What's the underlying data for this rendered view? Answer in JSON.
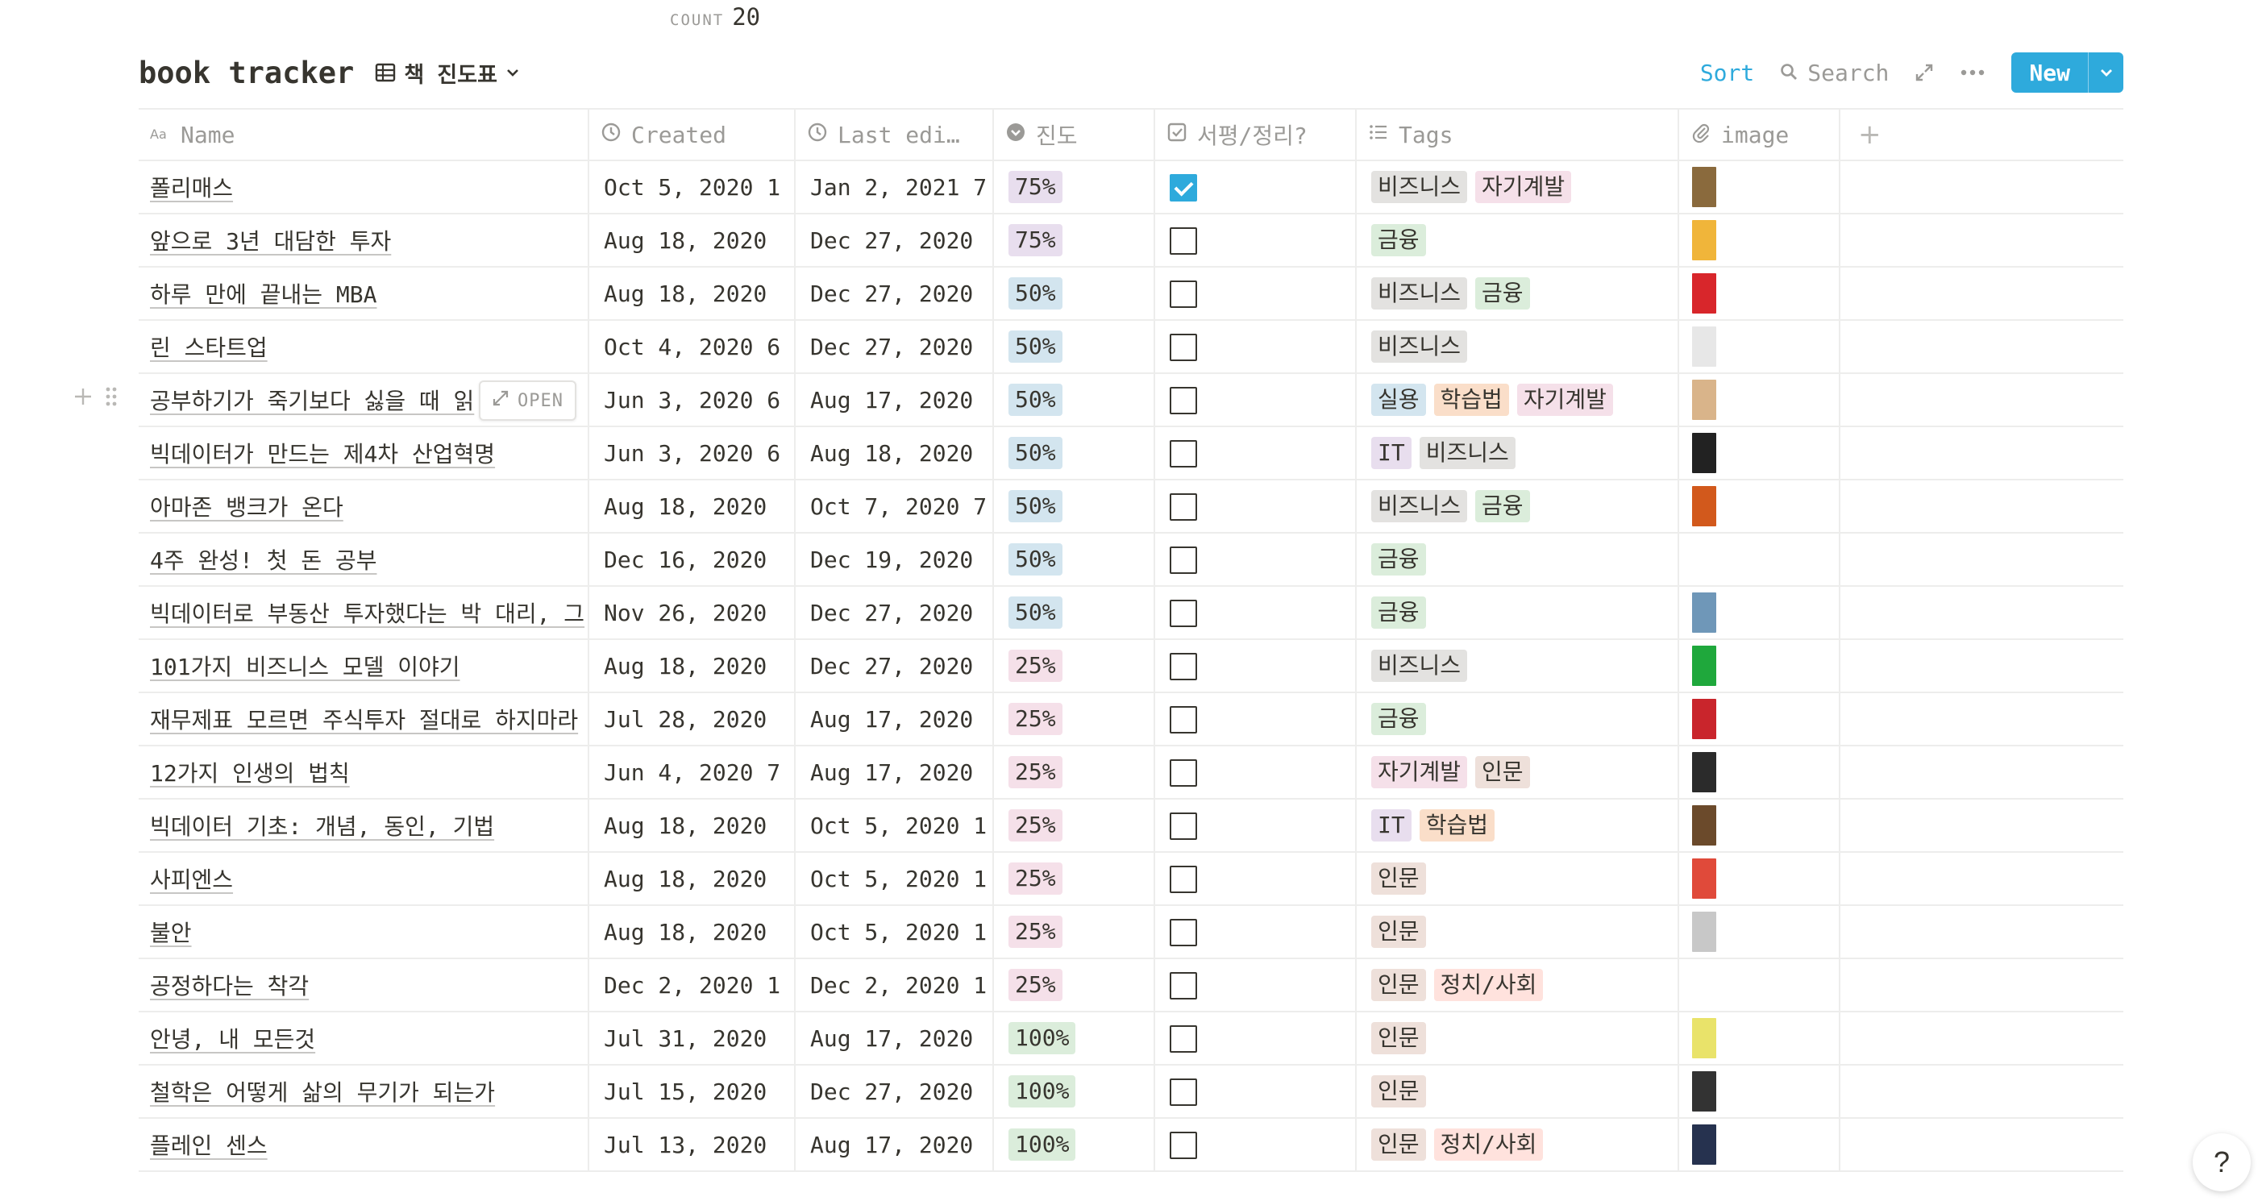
{
  "count": {
    "label": "COUNT",
    "value": "20"
  },
  "header": {
    "title": "book tracker",
    "view_name": "책 진도표",
    "sort": "Sort",
    "search": "Search",
    "new": "New"
  },
  "columns": [
    {
      "label": "Name",
      "icon": "text-property-icon"
    },
    {
      "label": "Created",
      "icon": "clock-icon"
    },
    {
      "label": "Last edi…",
      "icon": "clock-icon"
    },
    {
      "label": "진도",
      "icon": "select-icon"
    },
    {
      "label": "서평/정리?",
      "icon": "checkbox-icon"
    },
    {
      "label": "Tags",
      "icon": "list-icon"
    },
    {
      "label": "image",
      "icon": "paperclip-icon"
    }
  ],
  "add_column": "+",
  "open_button": "OPEN",
  "help": "?",
  "tag_colors": {
    "비즈니스": "#e3e2e0",
    "자기계발": "#f5e0e9",
    "금융": "#dbeddb",
    "실용": "#d3e5ef",
    "학습법": "#fadec9",
    "IT": "#e8deee",
    "인문": "#eee0da",
    "정치/사회": "#ffe2dd"
  },
  "progress_colors": {
    "75%": "#e8deee",
    "50%": "#d3e5ef",
    "25%": "#f5e0e9",
    "100%": "#dbeddb"
  },
  "rows": [
    {
      "name": "폴리매스",
      "created": "Oct 5, 2020 1",
      "edited": "Jan 2, 2021 7",
      "progress": "75%",
      "checked": true,
      "tags": [
        "비즈니스",
        "자기계발"
      ],
      "image": "#8a6a3d"
    },
    {
      "name": "앞으로 3년 대담한 투자",
      "created": "Aug 18, 2020",
      "edited": "Dec 27, 2020",
      "progress": "75%",
      "checked": false,
      "tags": [
        "금융"
      ],
      "image": "#f0b53a"
    },
    {
      "name": "하루 만에 끝내는 MBA",
      "created": "Aug 18, 2020",
      "edited": "Dec 27, 2020",
      "progress": "50%",
      "checked": false,
      "tags": [
        "비즈니스",
        "금융"
      ],
      "image": "#d8262b"
    },
    {
      "name": "린 스타트업",
      "created": "Oct 4, 2020 6",
      "edited": "Dec 27, 2020",
      "progress": "50%",
      "checked": false,
      "tags": [
        "비즈니스"
      ],
      "image": "#e7e7e7"
    },
    {
      "name": "공부하기가 죽기보다 싫을 때 읽",
      "created": "Jun 3, 2020 6",
      "edited": "Aug 17, 2020",
      "progress": "50%",
      "checked": false,
      "tags": [
        "실용",
        "학습법",
        "자기계발"
      ],
      "image": "#d9b48a"
    },
    {
      "name": "빅데이터가 만드는 제4차 산업혁명",
      "created": "Jun 3, 2020 6",
      "edited": "Aug 18, 2020",
      "progress": "50%",
      "checked": false,
      "tags": [
        "IT",
        "비즈니스"
      ],
      "image": "#222222"
    },
    {
      "name": "아마존 뱅크가 온다",
      "created": "Aug 18, 2020",
      "edited": "Oct 7, 2020 7",
      "progress": "50%",
      "checked": false,
      "tags": [
        "비즈니스",
        "금융"
      ],
      "image": "#d2591c"
    },
    {
      "name": "4주 완성! 첫 돈 공부",
      "created": "Dec 16, 2020",
      "edited": "Dec 19, 2020",
      "progress": "50%",
      "checked": false,
      "tags": [
        "금융"
      ],
      "image": ""
    },
    {
      "name": "빅데이터로 부동산 투자했다는 박 대리, 그",
      "created": "Nov 26, 2020",
      "edited": "Dec 27, 2020",
      "progress": "50%",
      "checked": false,
      "tags": [
        "금융"
      ],
      "image": "#6f97b8"
    },
    {
      "name": "101가지 비즈니스 모델 이야기",
      "created": "Aug 18, 2020",
      "edited": "Dec 27, 2020",
      "progress": "25%",
      "checked": false,
      "tags": [
        "비즈니스"
      ],
      "image": "#1fa83c"
    },
    {
      "name": "재무제표 모르면 주식투자 절대로 하지마라",
      "created": "Jul 28, 2020",
      "edited": "Aug 17, 2020",
      "progress": "25%",
      "checked": false,
      "tags": [
        "금융"
      ],
      "image": "#c9252c"
    },
    {
      "name": "12가지 인생의 법칙",
      "created": "Jun 4, 2020 7",
      "edited": "Aug 17, 2020",
      "progress": "25%",
      "checked": false,
      "tags": [
        "자기계발",
        "인문"
      ],
      "image": "#2b2b2b"
    },
    {
      "name": "빅데이터 기초: 개념, 동인, 기법",
      "created": "Aug 18, 2020",
      "edited": "Oct 5, 2020 1",
      "progress": "25%",
      "checked": false,
      "tags": [
        "IT",
        "학습법"
      ],
      "image": "#6b4a2b"
    },
    {
      "name": "사피엔스",
      "created": "Aug 18, 2020",
      "edited": "Oct 5, 2020 1",
      "progress": "25%",
      "checked": false,
      "tags": [
        "인문"
      ],
      "image": "#e04a3a"
    },
    {
      "name": "불안",
      "created": "Aug 18, 2020",
      "edited": "Oct 5, 2020 1",
      "progress": "25%",
      "checked": false,
      "tags": [
        "인문"
      ],
      "image": "#c8c8c8"
    },
    {
      "name": "공정하다는 착각",
      "created": "Dec 2, 2020 1",
      "edited": "Dec 2, 2020 1",
      "progress": "25%",
      "checked": false,
      "tags": [
        "인문",
        "정치/사회"
      ],
      "image": ""
    },
    {
      "name": "안녕, 내 모든것",
      "created": "Jul 31, 2020",
      "edited": "Aug 17, 2020",
      "progress": "100%",
      "checked": false,
      "tags": [
        "인문"
      ],
      "image": "#e9e36a"
    },
    {
      "name": "철학은 어떻게 삶의 무기가 되는가",
      "created": "Jul 15, 2020",
      "edited": "Dec 27, 2020",
      "progress": "100%",
      "checked": false,
      "tags": [
        "인문"
      ],
      "image": "#333333"
    },
    {
      "name": "플레인 센스",
      "created": "Jul 13, 2020",
      "edited": "Aug 17, 2020",
      "progress": "100%",
      "checked": false,
      "tags": [
        "인문",
        "정치/사회"
      ],
      "image": "#26324f"
    }
  ]
}
